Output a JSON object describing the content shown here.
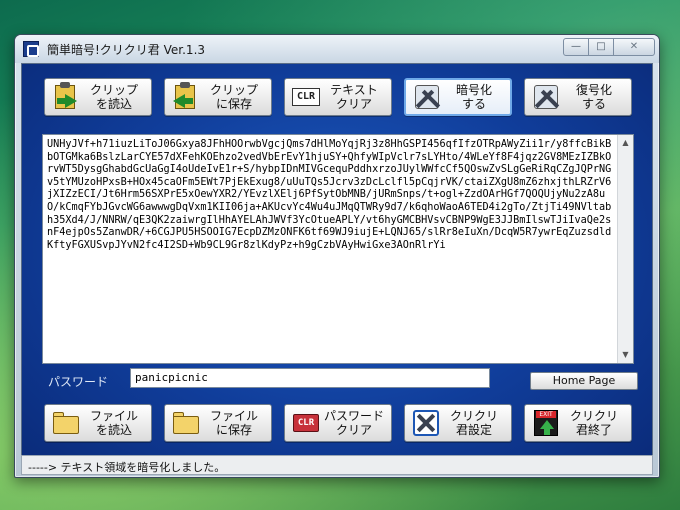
{
  "window": {
    "title": "簡単暗号!クリクリ君 Ver.1.3",
    "controls": {
      "minimize": "—",
      "maximize": "□",
      "close": "✕"
    }
  },
  "toolbar_top": [
    {
      "id": "clip-read",
      "label": "クリップ\nを読込",
      "icon": "clipboard-read-icon"
    },
    {
      "id": "clip-save",
      "label": "クリップ\nに保存",
      "icon": "clipboard-save-icon"
    },
    {
      "id": "text-clear",
      "label": "テキスト\nクリア",
      "icon": "clear-text-icon",
      "icon_text": "CLR"
    },
    {
      "id": "encrypt",
      "label": "暗号化\nする",
      "icon": "encrypt-icon"
    },
    {
      "id": "decrypt",
      "label": "復号化\nする",
      "icon": "decrypt-icon"
    }
  ],
  "toolbar_bottom": [
    {
      "id": "file-read",
      "label": "ファイル\nを読込",
      "icon": "folder-open-icon"
    },
    {
      "id": "file-save",
      "label": "ファイル\nに保存",
      "icon": "folder-save-icon"
    },
    {
      "id": "pw-clear",
      "label": "パスワード\nクリア",
      "icon": "password-clear-icon",
      "icon_text": "CLR"
    },
    {
      "id": "settings",
      "label": "クリクリ\n君設定",
      "icon": "settings-icon"
    },
    {
      "id": "exit",
      "label": "クリクリ\n君終了",
      "icon": "exit-icon",
      "icon_text": "EXIT"
    }
  ],
  "editor": {
    "content": "UNHyJVf+h71iuzLiToJ06Gxya8JFhHOOrwbVgcjQms7dHlMoYqjRj3z8HhGSPI456qfIfzOTRpAWyZii1r/y8ffcBikBbOTGMka6BslzLarCYE57dXFehKOEhzo2vedVbErEvY1hjuSY+QhfyWIpVclr7sLYHto/4WLeYf8F4jqz2GV8MEzIZBkOrvWT5DysgGhabdGcUaGgI4oUdeIvE1r+S/hybpIDnMIVGcequPddhxrzoJUylWWfcCf5QOswZvSLgGeRiRqCZgJQPrNGv5tYMUzoHPxsB+HOx45caOFm5EWt7PjEkExug8/uUuTQs5Jcrv3zDcLclfl5pCqjrVK/ctaiZXgU8mZ6zhxjthLRZrV6jXIZzECI/Jt6Hrm56SXPrE5xOewYXR2/YEvzlXElj6PfSytObMNB/jURmSnps/t+ogl+ZzdOArHGf7QOQUjyNu2zA8uO/kCmqFYbJGvcWG6awwwgDqVxm1KII06ja+AKUcvYc4Wu4uJMqQTWRy9d7/k6qhoWaoA6TED4i2gTo/ZtjTi49NVltabh35Xd4/J/NNRW/qE3QK2zaiwrgIlHhAYELAhJWVf3YcOtueAPLY/vt6hyGMCBHVsvCBNP9WgE3JJBmIlswTJiIvaQe2snF4ejpOs5ZanwDR/+6CGJPU5HSOOIG7EcpDZMzONFK6tf69WJ9iujE+LQNJ65/slRr8eIuXn/DcqW5R7ywrEqZuzsdldKftyFGXUSvpJYvN2fc4I2SD+Wb9CL9Gr8zlKdyPz+h9gCzbVAyHwiGxe3AOnRlrYi"
  },
  "password": {
    "label": "パスワード",
    "value": "panicpicnic"
  },
  "home_button": "Home Page",
  "status": "-----> テキスト領域を暗号化しました。"
}
